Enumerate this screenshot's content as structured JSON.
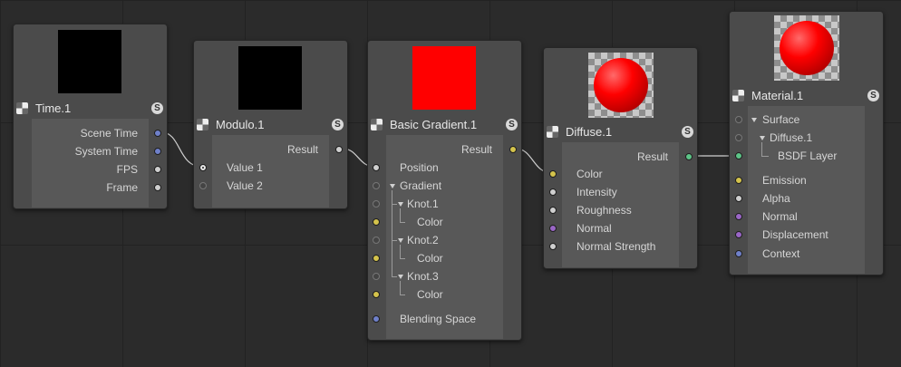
{
  "nodes": {
    "time": {
      "title": "Time.1",
      "outputs": [
        "Scene Time",
        "System Time",
        "FPS",
        "Frame"
      ]
    },
    "modulo": {
      "title": "Modulo.1",
      "result": "Result",
      "inputs": [
        "Value 1",
        "Value 2"
      ]
    },
    "gradient": {
      "title": "Basic Gradient.1",
      "result": "Result",
      "inputs": [
        "Position",
        "Gradient",
        "Knot.1",
        "Color",
        "Knot.2",
        "Color",
        "Knot.3",
        "Color",
        "Blending Space"
      ]
    },
    "diffuse": {
      "title": "Diffuse.1",
      "result": "Result",
      "inputs": [
        "Color",
        "Intensity",
        "Roughness",
        "Normal",
        "Normal Strength"
      ]
    },
    "material": {
      "title": "Material.1",
      "inputs": [
        "Surface",
        "Diffuse.1",
        "BSDF Layer",
        "Emission",
        "Alpha",
        "Normal",
        "Displacement",
        "Context"
      ]
    }
  },
  "badge": "S",
  "colors": {
    "preview_black": "#000000",
    "preview_red": "#ff0000",
    "port_blue": "#6f80c9",
    "port_yellow": "#d4c34c",
    "port_green": "#5dc487",
    "port_purple": "#9a66c6"
  }
}
